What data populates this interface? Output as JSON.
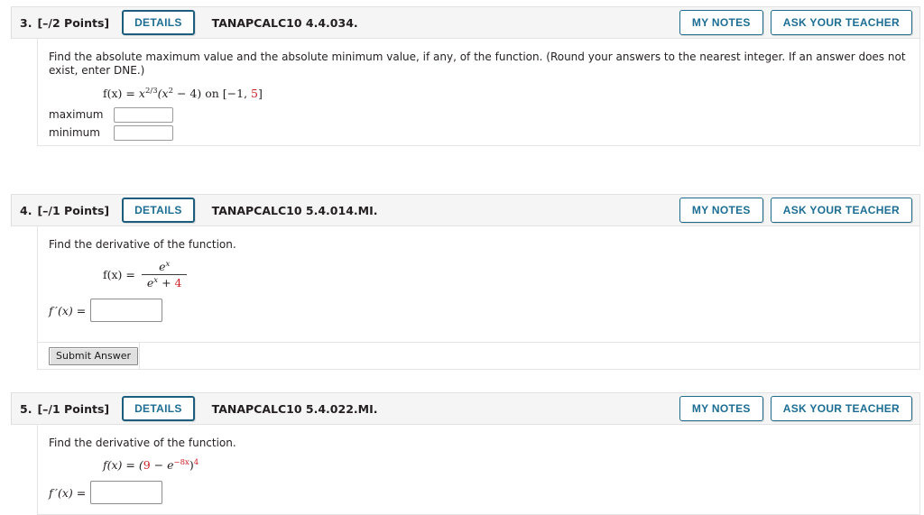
{
  "buttons": {
    "details": "DETAILS",
    "my_notes": "MY NOTES",
    "ask_your_teacher": "ASK YOUR TEACHER",
    "submit_answer": "Submit Answer"
  },
  "questions": [
    {
      "number": "3.",
      "points": "[–/2 Points]",
      "code": "TANAPCALC10 4.4.034.",
      "prompt": "Find the absolute maximum value and the absolute minimum value, if any, of the function. (Round your answers to the nearest integer. If an answer does not exist, enter DNE.)",
      "equation": {
        "lhs": "f(x) =",
        "base": "x",
        "exponent": "2/3",
        "group": "(x",
        "group_exp": "2",
        "group_rest": " − 4) on [−1, ",
        "interval_right_red": "5",
        "group_close": "]"
      },
      "answers": [
        {
          "label": "maximum",
          "value": "",
          "placeholder": ""
        },
        {
          "label": "minimum",
          "value": "",
          "placeholder": ""
        }
      ]
    },
    {
      "number": "4.",
      "points": "[–/1 Points]",
      "code": "TANAPCALC10 5.4.014.MI.",
      "prompt": "Find the derivative of the function.",
      "equation": {
        "lhs": "f(x) =",
        "numerator_base": "e",
        "numerator_exp": "x",
        "denominator_base": "e",
        "denominator_exp": "x",
        "denominator_op": " + ",
        "denominator_red": "4"
      },
      "derivative_label": "f ′(x) =",
      "derivative_value": "",
      "has_submit": true
    },
    {
      "number": "5.",
      "points": "[–/1 Points]",
      "code": "TANAPCALC10 5.4.022.MI.",
      "prompt": "Find the derivative of the function.",
      "equation": {
        "lhs": "f(x) = (",
        "red_coeff": "9",
        "op": " − e",
        "red_exp": "−8x",
        "close": ")",
        "outer_exp": "4"
      },
      "derivative_label": "f ′(x) =",
      "derivative_value": "",
      "has_submit": false
    }
  ]
}
